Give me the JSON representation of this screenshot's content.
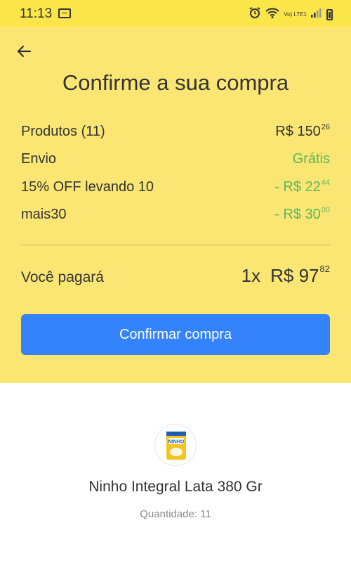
{
  "status_bar": {
    "time": "11:13",
    "left_icon": "cast-icon",
    "network_label": "Vo) LTE1"
  },
  "header": {
    "title": "Confirme a sua compra"
  },
  "summary": {
    "rows": [
      {
        "label": "Produtos (11)",
        "value_main": "R$ 150",
        "value_cents": "26",
        "color": "#333333"
      },
      {
        "label": "Envio",
        "value_main": "Grátis",
        "value_cents": "",
        "color": "#5bb75b"
      },
      {
        "label": "15% OFF levando 10",
        "value_main": "- R$ 22",
        "value_cents": "44",
        "color": "#5bb75b"
      },
      {
        "label": "mais30",
        "value_main": "- R$ 30",
        "value_cents": "00",
        "color": "#5bb75b"
      }
    ],
    "total_label": "Você pagará",
    "total_qty": "1x",
    "total_main": "R$ 97",
    "total_cents": "82"
  },
  "confirm_button": {
    "label": "Confirmar compra",
    "color": "#3483fa"
  },
  "product": {
    "name": "Ninho Integral Lata 380 Gr",
    "quantity": "Quantidade: 11",
    "image_brand": "NINHO"
  },
  "colors": {
    "yellow": "#fbe673",
    "green": "#5bb75b",
    "blue": "#3483fa"
  }
}
